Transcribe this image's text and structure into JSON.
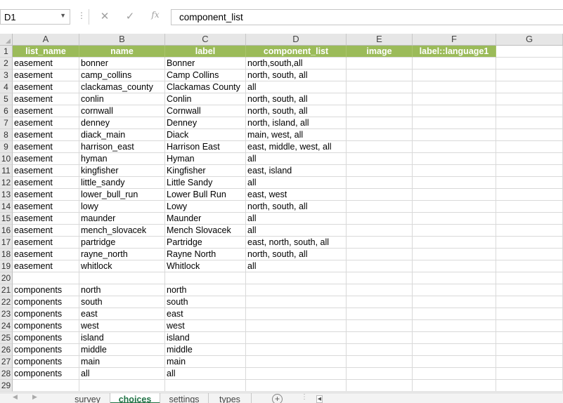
{
  "name_box": "D1",
  "formula_bar": {
    "value": "component_list",
    "fx_label": "fx",
    "cancel_glyph": "✕",
    "enter_glyph": "✓",
    "dots": "⋮"
  },
  "columns": [
    "A",
    "B",
    "C",
    "D",
    "E",
    "F",
    "G"
  ],
  "rows": [
    [
      "list_name",
      "name",
      "label",
      "component_list",
      "image",
      "label::language1"
    ],
    [
      "easement",
      "bonner",
      "Bonner",
      "north,south,all",
      "",
      ""
    ],
    [
      "easement",
      "camp_collins",
      "Camp Collins",
      "north, south, all",
      "",
      ""
    ],
    [
      "easement",
      "clackamas_county",
      "Clackamas County",
      "all",
      "",
      ""
    ],
    [
      "easement",
      "conlin",
      "Conlin",
      "north, south, all",
      "",
      ""
    ],
    [
      "easement",
      "cornwall",
      "Cornwall",
      "north, south, all",
      "",
      ""
    ],
    [
      "easement",
      "denney",
      "Denney",
      "north, island, all",
      "",
      ""
    ],
    [
      "easement",
      "diack_main",
      "Diack",
      "main, west, all",
      "",
      ""
    ],
    [
      "easement",
      "harrison_east",
      "Harrison East",
      "east, middle, west, all",
      "",
      ""
    ],
    [
      "easement",
      "hyman",
      "Hyman",
      "all",
      "",
      ""
    ],
    [
      "easement",
      "kingfisher",
      "Kingfisher",
      "east, island",
      "",
      ""
    ],
    [
      "easement",
      "little_sandy",
      "Little Sandy",
      "all",
      "",
      ""
    ],
    [
      "easement",
      "lower_bull_run",
      "Lower Bull Run",
      "east, west",
      "",
      ""
    ],
    [
      "easement",
      "lowy",
      "Lowy",
      "north, south, all",
      "",
      ""
    ],
    [
      "easement",
      "maunder",
      "Maunder",
      "all",
      "",
      ""
    ],
    [
      "easement",
      "mench_slovacek",
      "Mench Slovacek",
      "all",
      "",
      ""
    ],
    [
      "easement",
      "partridge",
      "Partridge",
      "east, north, south, all",
      "",
      ""
    ],
    [
      "easement",
      "rayne_north",
      "Rayne North",
      "north, south, all",
      "",
      ""
    ],
    [
      "easement",
      "whitlock",
      "Whitlock",
      "all",
      "",
      ""
    ],
    [
      "",
      "",
      "",
      "",
      "",
      ""
    ],
    [
      "components",
      "north",
      "north",
      "",
      "",
      ""
    ],
    [
      "components",
      "south",
      "south",
      "",
      "",
      ""
    ],
    [
      "components",
      "east",
      "east",
      "",
      "",
      ""
    ],
    [
      "components",
      "west",
      "west",
      "",
      "",
      ""
    ],
    [
      "components",
      "island",
      "island",
      "",
      "",
      ""
    ],
    [
      "components",
      "middle",
      "middle",
      "",
      "",
      ""
    ],
    [
      "components",
      "main",
      "main",
      "",
      "",
      ""
    ],
    [
      "components",
      "all",
      "all",
      "",
      "",
      ""
    ],
    [
      "",
      "",
      "",
      "",
      "",
      ""
    ]
  ],
  "sheet_tabs": [
    "survey",
    "choices",
    "settings",
    "types"
  ],
  "active_tab": "choices",
  "colors": {
    "header_fill": "#9bbb59",
    "header_text": "#ffffff",
    "active_tab": "#217346"
  }
}
